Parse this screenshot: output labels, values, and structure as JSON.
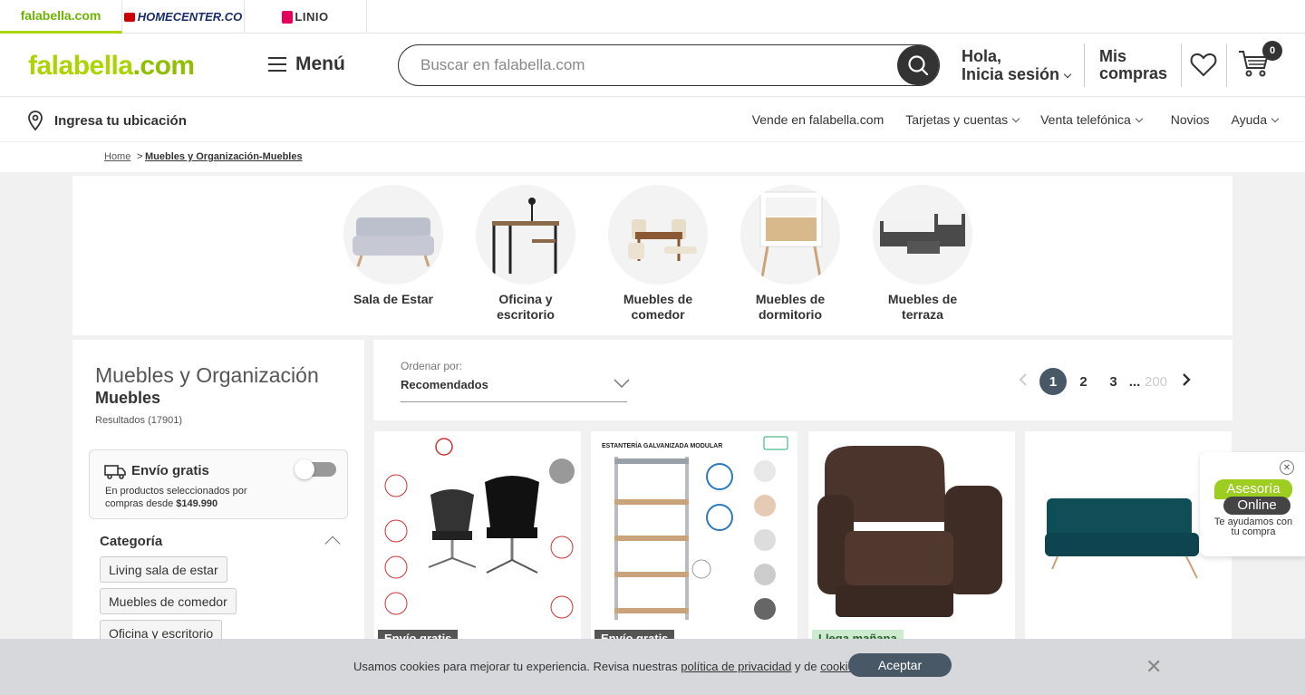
{
  "brands": {
    "falabella": "falabella.com",
    "homecenter": "HOMECENTER.CO",
    "linio": "LINIO"
  },
  "header": {
    "logo_main": "falabella",
    "logo_suffix": ".com",
    "menu_label": "Menú",
    "search_placeholder": "Buscar en falabella.com",
    "greeting_line1": "Hola,",
    "greeting_line2": "Inicia sesión",
    "mis_line1": "Mis",
    "mis_line2": "compras",
    "cart_count": "0"
  },
  "subnav": {
    "location": "Ingresa tu ubicación",
    "links": [
      "Vende en falabella.com",
      "Tarjetas y cuentas",
      "Venta telefónica",
      "Novios",
      "Ayuda"
    ]
  },
  "breadcrumb": {
    "home": "Home",
    "separator": ">",
    "current": "Muebles y Organización-Muebles"
  },
  "categories": [
    {
      "line1": "Sala de Estar",
      "line2": ""
    },
    {
      "line1": "Oficina y",
      "line2": "escritorio"
    },
    {
      "line1": "Muebles de",
      "line2": "comedor"
    },
    {
      "line1": "Muebles de",
      "line2": "dormitorio"
    },
    {
      "line1": "Muebles de",
      "line2": "terraza"
    }
  ],
  "sidebar": {
    "title_top": "Muebles y Organización",
    "title_bottom": "Muebles",
    "results": "Resultados (17901)",
    "envio_title": "Envío gratis",
    "envio_desc_1": "En productos seleccionados por",
    "envio_desc_2": "compras desde ",
    "envio_amount": "$149.990",
    "envio_toggle_on": false,
    "category_header": "Categoría",
    "category_chips": [
      "Living sala de estar",
      "Muebles de comedor",
      "Oficina y escritorio"
    ]
  },
  "sort": {
    "label": "Ordenar por:",
    "value": "Recomendados"
  },
  "pagination": {
    "current": "1",
    "pages": [
      "2",
      "3"
    ],
    "ellipsis": "...",
    "last": "200"
  },
  "products": [
    {
      "badge": "Envío gratis",
      "badge_style": "gray"
    },
    {
      "badge": "Envío gratis",
      "badge_style": "gray",
      "image_caption": "ESTANTERÍA GALVANIZADA MODULAR"
    },
    {
      "badge": "Llega mañana",
      "badge_style": "green"
    },
    {
      "badge": "",
      "badge_style": "none"
    }
  ],
  "chat": {
    "close": "✕",
    "pill1": "Asesoría",
    "pill2": "Online",
    "sub": "Te ayudamos con tu compra"
  },
  "cookie": {
    "text_before": "Usamos cookies para mejorar tu experiencia. Revisa nuestras ",
    "privacy_link": "política de privacidad",
    "text_middle": " y de ",
    "cookies_link": "cookies",
    "text_after": ".",
    "accept": "Aceptar",
    "close": "✕"
  },
  "colors": {
    "brand_green": "#aad500",
    "dark": "#333333",
    "pager_active": "#495867",
    "cookie_bg": "#d6d8db"
  }
}
